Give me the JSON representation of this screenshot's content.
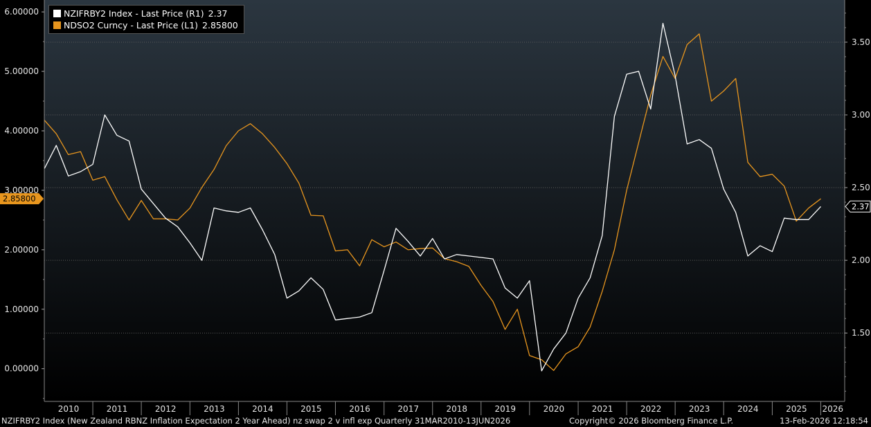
{
  "colors": {
    "white_series": "#ffffff",
    "orange_series": "#e8961e",
    "grid": "#5a5a5a",
    "axis_text": "#e6e6e6",
    "bg_top": "#2b3640",
    "bg_bottom": "#000000"
  },
  "legend": [
    {
      "label": "NZIFRBY2 Index - Last Price (R1)",
      "value": "2.37",
      "color": "#ffffff"
    },
    {
      "label": "NDSO2 Curncy - Last Price (L1)",
      "value": "2.85800",
      "color": "#e8961e"
    }
  ],
  "footer": {
    "left": "NZIFRBY2 Index (New Zealand RBNZ Inflation Expectation 2 Year Ahead) nz swap 2 v infl exp Quarterly 31MAR2010-13JUN2026",
    "center": "Copyright© 2026 Bloomberg Finance L.P.",
    "right": "13-Feb-2026 12:18:54"
  },
  "chart_data": {
    "type": "line",
    "x_range": [
      "2010-01-01",
      "2026-06-30"
    ],
    "x_ticks": [
      "2010",
      "2011",
      "2012",
      "2013",
      "2014",
      "2015",
      "2016",
      "2017",
      "2018",
      "2019",
      "2020",
      "2021",
      "2022",
      "2023",
      "2024",
      "2025",
      "2026"
    ],
    "left_axis": {
      "ylim": [
        -0.55,
        6.2
      ],
      "ticks": [
        "0.00000",
        "1.00000",
        "2.00000",
        "3.00000",
        "4.00000",
        "5.00000",
        "6.00000"
      ],
      "last_value_label": "2.85800"
    },
    "right_axis": {
      "ylim": [
        1.03,
        3.79
      ],
      "ticks": [
        "1.50",
        "2.00",
        "2.50",
        "3.00",
        "3.50"
      ],
      "last_value_label": "2.37"
    },
    "grid": true,
    "legend_position": "top-left",
    "series": [
      {
        "name": "NDSO2 Curncy - Last Price (L1)",
        "axis": "left",
        "color": "#e8961e",
        "points": [
          [
            "2010-01-01",
            4.18
          ],
          [
            "2010-04-01",
            3.95
          ],
          [
            "2010-07-01",
            3.6
          ],
          [
            "2010-10-01",
            3.65
          ],
          [
            "2011-01-01",
            3.17
          ],
          [
            "2011-04-01",
            3.23
          ],
          [
            "2011-07-01",
            2.84
          ],
          [
            "2011-10-01",
            2.5
          ],
          [
            "2012-01-01",
            2.83
          ],
          [
            "2012-04-01",
            2.52
          ],
          [
            "2012-07-01",
            2.52
          ],
          [
            "2012-10-01",
            2.5
          ],
          [
            "2013-01-01",
            2.7
          ],
          [
            "2013-04-01",
            3.05
          ],
          [
            "2013-07-01",
            3.35
          ],
          [
            "2013-10-01",
            3.75
          ],
          [
            "2014-01-01",
            4.0
          ],
          [
            "2014-04-01",
            4.12
          ],
          [
            "2014-07-01",
            3.95
          ],
          [
            "2014-10-01",
            3.72
          ],
          [
            "2015-01-01",
            3.45
          ],
          [
            "2015-04-01",
            3.12
          ],
          [
            "2015-07-01",
            2.58
          ],
          [
            "2015-10-01",
            2.57
          ],
          [
            "2016-01-01",
            1.98
          ],
          [
            "2016-04-01",
            2.0
          ],
          [
            "2016-07-01",
            1.73
          ],
          [
            "2016-10-01",
            2.17
          ],
          [
            "2017-01-01",
            2.05
          ],
          [
            "2017-04-01",
            2.13
          ],
          [
            "2017-07-01",
            2.0
          ],
          [
            "2017-10-01",
            2.02
          ],
          [
            "2018-01-01",
            2.03
          ],
          [
            "2018-04-01",
            1.85
          ],
          [
            "2018-07-01",
            1.8
          ],
          [
            "2018-10-01",
            1.72
          ],
          [
            "2019-01-01",
            1.4
          ],
          [
            "2019-04-01",
            1.13
          ],
          [
            "2019-07-01",
            0.66
          ],
          [
            "2019-10-01",
            1.0
          ],
          [
            "2020-01-01",
            0.22
          ],
          [
            "2020-04-01",
            0.15
          ],
          [
            "2020-07-01",
            -0.03
          ],
          [
            "2020-10-01",
            0.25
          ],
          [
            "2021-01-01",
            0.37
          ],
          [
            "2021-04-01",
            0.7
          ],
          [
            "2021-07-01",
            1.3
          ],
          [
            "2021-10-01",
            2.0
          ],
          [
            "2022-01-01",
            3.0
          ],
          [
            "2022-04-01",
            3.8
          ],
          [
            "2022-07-01",
            4.6
          ],
          [
            "2022-10-01",
            5.25
          ],
          [
            "2023-01-01",
            4.88
          ],
          [
            "2023-04-01",
            5.45
          ],
          [
            "2023-07-01",
            5.63
          ],
          [
            "2023-10-01",
            4.5
          ],
          [
            "2024-01-01",
            4.67
          ],
          [
            "2024-04-01",
            4.88
          ],
          [
            "2024-07-01",
            3.47
          ],
          [
            "2024-10-01",
            3.23
          ],
          [
            "2025-01-01",
            3.27
          ],
          [
            "2025-04-01",
            3.07
          ],
          [
            "2025-07-01",
            2.48
          ],
          [
            "2025-10-01",
            2.7
          ],
          [
            "2026-01-01",
            2.858
          ]
        ]
      },
      {
        "name": "NZIFRBY2 Index - Last Price (R1)",
        "axis": "right",
        "color": "#ffffff",
        "points": [
          [
            "2010-01-01",
            2.63
          ],
          [
            "2010-04-01",
            2.79
          ],
          [
            "2010-07-01",
            2.58
          ],
          [
            "2010-10-01",
            2.61
          ],
          [
            "2011-01-01",
            2.66
          ],
          [
            "2011-04-01",
            3.0
          ],
          [
            "2011-07-01",
            2.86
          ],
          [
            "2011-10-01",
            2.82
          ],
          [
            "2012-01-01",
            2.49
          ],
          [
            "2012-04-01",
            2.39
          ],
          [
            "2012-07-01",
            2.29
          ],
          [
            "2012-10-01",
            2.23
          ],
          [
            "2013-01-01",
            2.12
          ],
          [
            "2013-04-01",
            2.0
          ],
          [
            "2013-07-01",
            2.36
          ],
          [
            "2013-10-01",
            2.34
          ],
          [
            "2014-01-01",
            2.33
          ],
          [
            "2014-04-01",
            2.36
          ],
          [
            "2014-07-01",
            2.21
          ],
          [
            "2014-10-01",
            2.04
          ],
          [
            "2015-01-01",
            1.74
          ],
          [
            "2015-04-01",
            1.79
          ],
          [
            "2015-07-01",
            1.88
          ],
          [
            "2015-10-01",
            1.8
          ],
          [
            "2016-01-01",
            1.59
          ],
          [
            "2016-04-01",
            1.6
          ],
          [
            "2016-07-01",
            1.61
          ],
          [
            "2016-10-01",
            1.64
          ],
          [
            "2017-01-01",
            1.93
          ],
          [
            "2017-04-01",
            2.22
          ],
          [
            "2017-07-01",
            2.13
          ],
          [
            "2017-10-01",
            2.03
          ],
          [
            "2018-01-01",
            2.15
          ],
          [
            "2018-04-01",
            2.01
          ],
          [
            "2018-07-01",
            2.04
          ],
          [
            "2018-10-01",
            2.03
          ],
          [
            "2019-01-01",
            2.02
          ],
          [
            "2019-04-01",
            2.01
          ],
          [
            "2019-07-01",
            1.81
          ],
          [
            "2019-10-01",
            1.74
          ],
          [
            "2020-01-01",
            1.86
          ],
          [
            "2020-04-01",
            1.24
          ],
          [
            "2020-07-01",
            1.39
          ],
          [
            "2020-10-01",
            1.5
          ],
          [
            "2021-01-01",
            1.74
          ],
          [
            "2021-04-01",
            1.88
          ],
          [
            "2021-07-01",
            2.17
          ],
          [
            "2021-10-01",
            2.99
          ],
          [
            "2022-01-01",
            3.28
          ],
          [
            "2022-04-01",
            3.3
          ],
          [
            "2022-07-01",
            3.04
          ],
          [
            "2022-10-01",
            3.63
          ],
          [
            "2023-01-01",
            3.27
          ],
          [
            "2023-04-01",
            2.8
          ],
          [
            "2023-07-01",
            2.83
          ],
          [
            "2023-10-01",
            2.77
          ],
          [
            "2024-01-01",
            2.49
          ],
          [
            "2024-04-01",
            2.33
          ],
          [
            "2024-07-01",
            2.03
          ],
          [
            "2024-10-01",
            2.1
          ],
          [
            "2025-01-01",
            2.06
          ],
          [
            "2025-04-01",
            2.29
          ],
          [
            "2025-07-01",
            2.28
          ],
          [
            "2025-10-01",
            2.28
          ],
          [
            "2026-01-01",
            2.37
          ]
        ]
      }
    ]
  }
}
